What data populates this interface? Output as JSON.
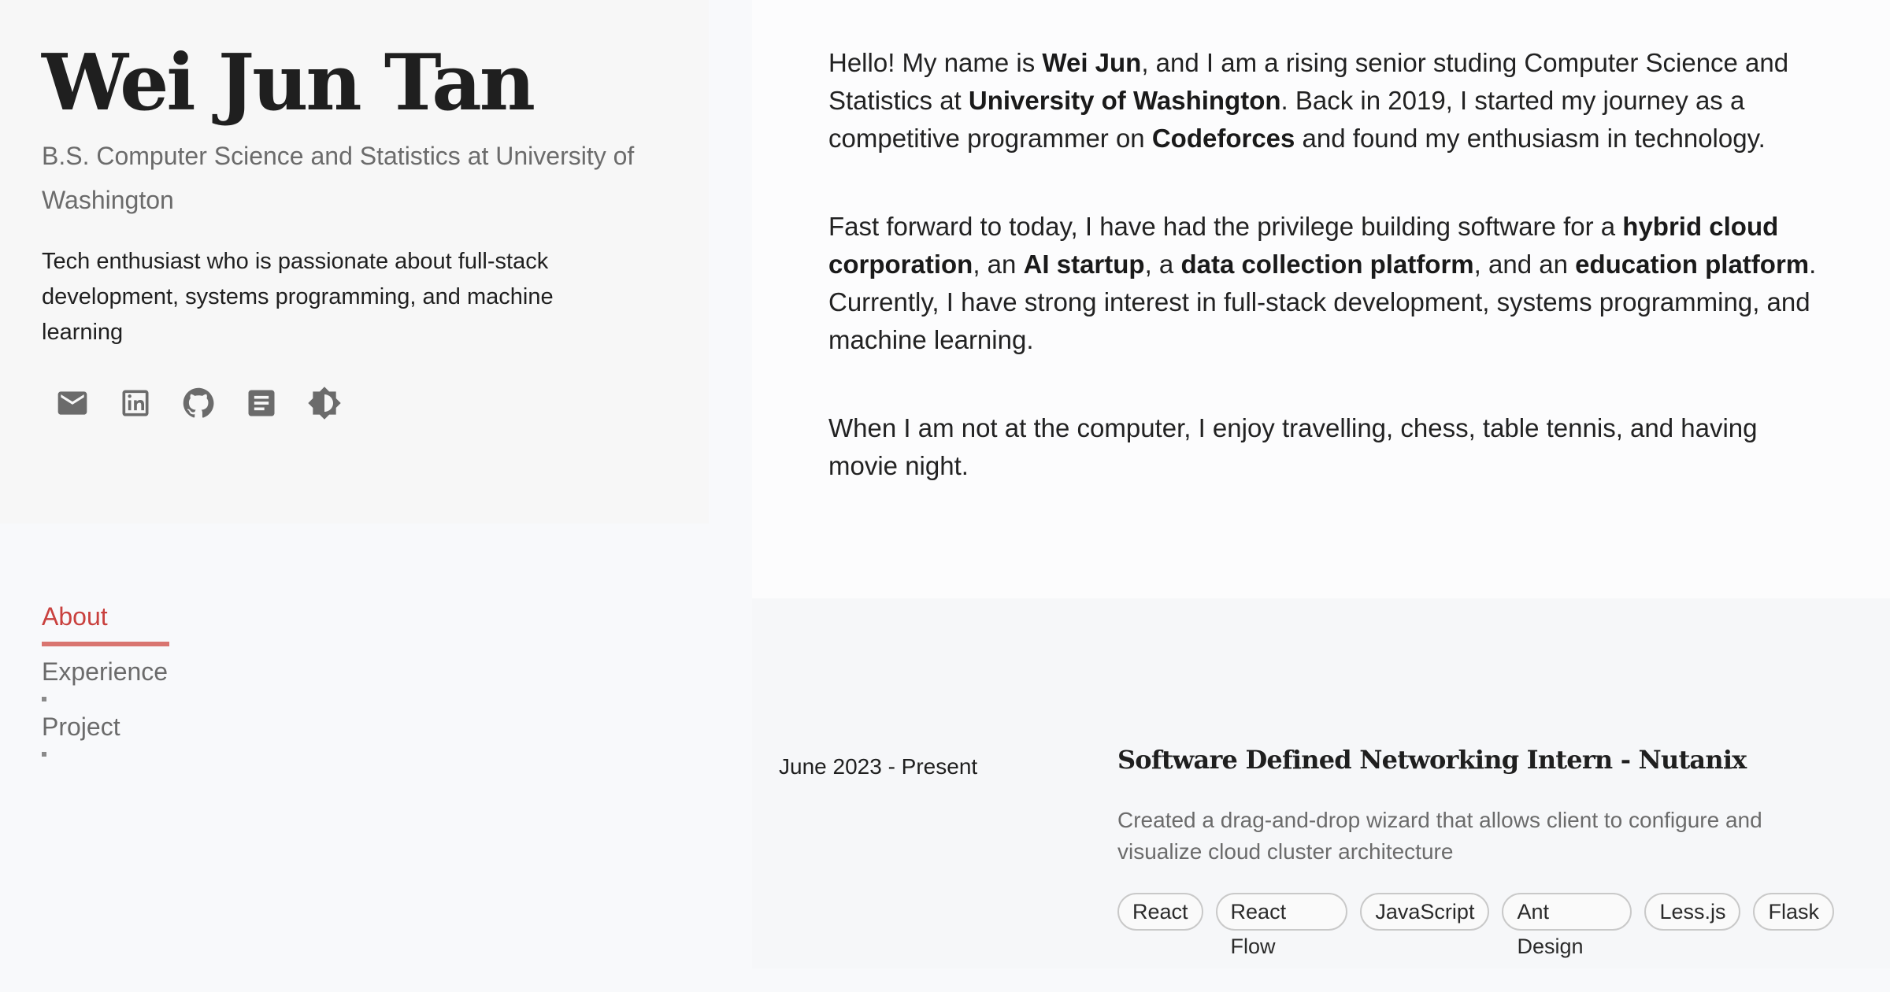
{
  "profile": {
    "name": "Wei Jun Tan",
    "degree": "B.S. Computer Science and Statistics at University of Washington",
    "tagline": "Tech enthusiast who is passionate about full-stack development, systems programming, and machine learning"
  },
  "social_icons": [
    "mail-icon",
    "linkedin-icon",
    "github-icon",
    "document-icon",
    "brightness-icon"
  ],
  "nav": {
    "about": "About",
    "experience": "Experience",
    "project": "Project",
    "active": "About"
  },
  "about": {
    "p1": [
      {
        "t": "Hello! My name is ",
        "b": false
      },
      {
        "t": "Wei Jun",
        "b": true
      },
      {
        "t": ", and I am a rising senior studing Computer Science and Statistics at ",
        "b": false
      },
      {
        "t": "University of Washington",
        "b": true
      },
      {
        "t": ". Back in 2019, I started my journey as a competitive programmer on ",
        "b": false
      },
      {
        "t": "Codeforces",
        "b": true
      },
      {
        "t": " and found my enthusiasm in technology.",
        "b": false
      }
    ],
    "p2": [
      {
        "t": "Fast forward to today, I have had the privilege building software for a ",
        "b": false
      },
      {
        "t": "hybrid cloud corporation",
        "b": true
      },
      {
        "t": ", an ",
        "b": false
      },
      {
        "t": "AI startup",
        "b": true
      },
      {
        "t": ", a ",
        "b": false
      },
      {
        "t": "data collection platform",
        "b": true
      },
      {
        "t": ", and an ",
        "b": false
      },
      {
        "t": "education platform",
        "b": true
      },
      {
        "t": ". Currently, I have strong interest in full-stack development, systems programming, and machine learning.",
        "b": false
      }
    ],
    "p3": [
      {
        "t": "When I am not at the computer, I enjoy travelling, chess, table tennis, and having movie night.",
        "b": false
      }
    ]
  },
  "experience": [
    {
      "date": "June 2023 - Present",
      "title": "Software Defined Networking Intern - Nutanix",
      "description": "Created a drag-and-drop wizard that allows client to configure and visualize cloud cluster architecture",
      "tags": [
        "React",
        "React Flow",
        "JavaScript",
        "Ant Design",
        "Less.js",
        "Flask"
      ]
    }
  ],
  "colors": {
    "accent": "#c9413e",
    "accent_bar": "#d97570",
    "muted_text": "#6b6b6b",
    "background": "#f8f9fb"
  }
}
